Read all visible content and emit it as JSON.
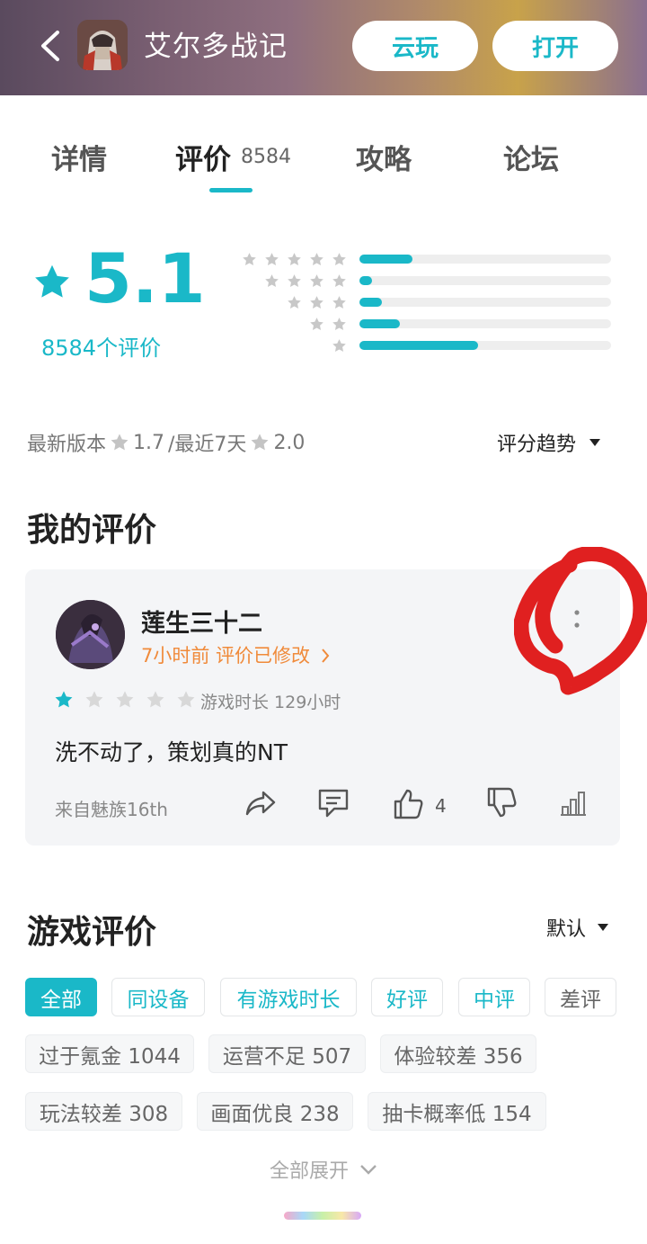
{
  "header": {
    "app_title": "艾尔多战记",
    "cloud_play_label": "云玩",
    "open_label": "打开"
  },
  "tabs": [
    {
      "label": "详情"
    },
    {
      "label": "评价",
      "count": "8584",
      "active": true
    },
    {
      "label": "攻略"
    },
    {
      "label": "论坛"
    }
  ],
  "rating": {
    "score": "5.1",
    "count_label": "8584个评价",
    "distribution": [
      {
        "stars": 5,
        "fraction": 0.21
      },
      {
        "stars": 4,
        "fraction": 0.05
      },
      {
        "stars": 3,
        "fraction": 0.09
      },
      {
        "stars": 2,
        "fraction": 0.16
      },
      {
        "stars": 1,
        "fraction": 0.47
      }
    ]
  },
  "versions": {
    "latest_label": "最新版本",
    "latest_score": "1.7",
    "recent_label": "/最近7天",
    "recent_score": "2.0",
    "trend_label": "评分趋势"
  },
  "my_review": {
    "section_title": "我的评价",
    "username": "莲生三十二",
    "meta": "7小时前 评价已修改",
    "rating": 1,
    "max_rating": 5,
    "playtime": "游戏时长 129小时",
    "text": "洗不动了，策划真的NT",
    "device": "来自魅族16th",
    "likes": "4"
  },
  "game_reviews": {
    "section_title": "游戏评价",
    "sort_label": "默认",
    "filters": [
      "全部",
      "同设备",
      "有游戏时长",
      "好评",
      "中评",
      "差评"
    ],
    "tags": [
      {
        "label": "过于氪金 1044"
      },
      {
        "label": "运营不足 507"
      },
      {
        "label": "体验较差 356"
      },
      {
        "label": "玩法较差 308"
      },
      {
        "label": "画面优良 238"
      },
      {
        "label": "抽卡概率低 154"
      }
    ],
    "expand_label": "全部展开"
  },
  "colors": {
    "accent": "#1ab8c8",
    "orange": "#f08a3a",
    "annotation_red": "#e02020"
  }
}
